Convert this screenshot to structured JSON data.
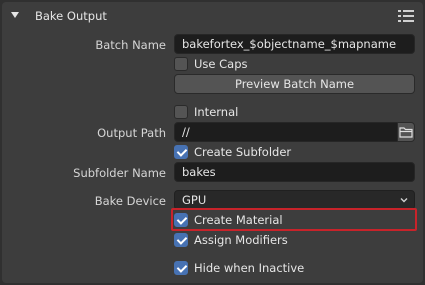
{
  "panel": {
    "title": "Bake Output",
    "colors": {
      "accent": "#4772b3",
      "highlight": "#c8232a"
    }
  },
  "batch_name": {
    "label": "Batch Name",
    "value": "bakefortex_$objectname_$mapname"
  },
  "use_caps": {
    "label": "Use Caps",
    "checked": false
  },
  "preview_button": {
    "label": "Preview Batch Name"
  },
  "internal": {
    "label": "Internal",
    "checked": false
  },
  "output_path": {
    "label": "Output Path",
    "value": "//",
    "icon": "folder-icon"
  },
  "create_subfolder": {
    "label": "Create Subfolder",
    "checked": true
  },
  "subfolder_name": {
    "label": "Subfolder Name",
    "value": "bakes"
  },
  "bake_device": {
    "label": "Bake Device",
    "value": "GPU"
  },
  "create_material": {
    "label": "Create Material",
    "checked": true
  },
  "assign_modifiers": {
    "label": "Assign Modifiers",
    "checked": true
  },
  "hide_when_inactive": {
    "label": "Hide when Inactive",
    "checked": true
  }
}
